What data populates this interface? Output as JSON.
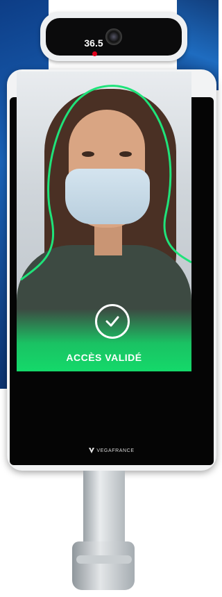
{
  "screen": {
    "temperature": "36.5",
    "status_text": "ACCÈS VALIDÉ",
    "status_icon": "check-icon",
    "accent_color": "#14d96a",
    "temp_marker_color": "#e0001b"
  },
  "brand": {
    "name": "VEGAFRANCE",
    "logo_icon": "v-logo-icon"
  }
}
